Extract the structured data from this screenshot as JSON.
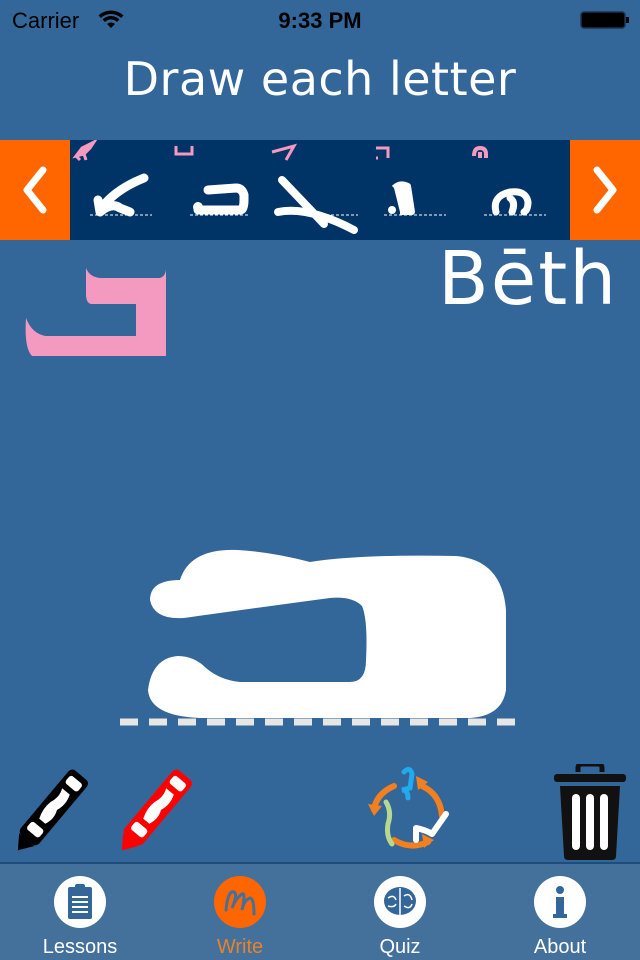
{
  "status_bar": {
    "carrier": "Carrier",
    "time": "9:33 PM",
    "wifi_icon": "wifi-icon",
    "battery_icon": "battery-full-icon"
  },
  "header": {
    "title": "Draw each letter"
  },
  "letter_strip": {
    "prev_label": "previous-letters",
    "next_label": "next-letters",
    "letters": [
      {
        "name": "Alaph",
        "index": 0
      },
      {
        "name": "Beth",
        "index": 1
      },
      {
        "name": "Gamal",
        "index": 2
      },
      {
        "name": "Dalath",
        "index": 3
      },
      {
        "name": "He",
        "index": 4
      }
    ]
  },
  "current_letter": {
    "name": "Bēth"
  },
  "tools": {
    "black_crayon": "black-crayon",
    "red_crayon": "red-crayon",
    "cycle": "cycle-letters",
    "trash": "clear-drawing"
  },
  "tab_bar": {
    "tabs": [
      {
        "label": "Lessons",
        "icon": "clipboard-icon",
        "active": false
      },
      {
        "label": "Write",
        "icon": "scribble-icon",
        "active": true
      },
      {
        "label": "Quiz",
        "icon": "brain-icon",
        "active": false
      },
      {
        "label": "About",
        "icon": "info-icon",
        "active": false
      }
    ]
  },
  "colors": {
    "background": "#336699",
    "strip": "#003366",
    "accent": "#ff6600",
    "pink": "#f49ac1",
    "active_tab_label": "#e8832a"
  }
}
